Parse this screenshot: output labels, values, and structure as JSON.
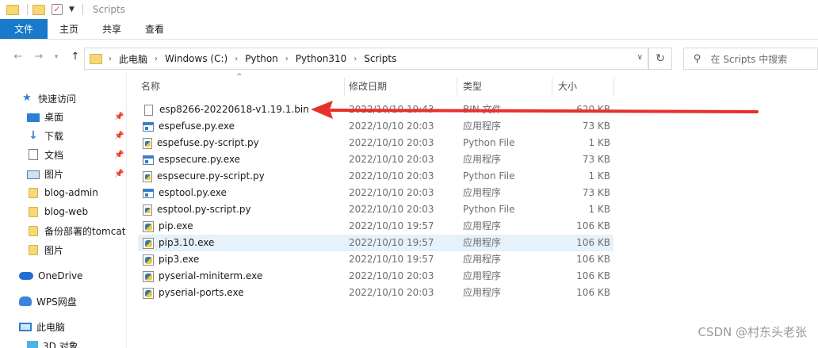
{
  "titlebar": {
    "title": "Scripts"
  },
  "ribbon": {
    "tabs": [
      "文件",
      "主页",
      "共享",
      "查看"
    ]
  },
  "address": {
    "breadcrumbs": [
      "此电脑",
      "Windows (C:)",
      "Python",
      "Python310",
      "Scripts"
    ]
  },
  "search": {
    "placeholder": "在 Scripts 中搜索"
  },
  "nav": {
    "quick_access": "快速访问",
    "items": [
      {
        "label": "桌面",
        "icon": "desktop-icon",
        "pinned": true
      },
      {
        "label": "下载",
        "icon": "download-icon",
        "pinned": true
      },
      {
        "label": "文档",
        "icon": "document-icon",
        "pinned": true
      },
      {
        "label": "图片",
        "icon": "picture-icon",
        "pinned": true
      },
      {
        "label": "blog-admin",
        "icon": "folder-icon",
        "pinned": false
      },
      {
        "label": "blog-web",
        "icon": "folder-icon",
        "pinned": false
      },
      {
        "label": "备份部署的tomcat",
        "icon": "folder-icon",
        "pinned": false
      },
      {
        "label": "图片",
        "icon": "folder-icon",
        "pinned": false
      }
    ],
    "onedrive": "OneDrive",
    "wps": "WPS网盘",
    "this_pc": "此电脑",
    "objects_3d": "3D 对象"
  },
  "columns": {
    "name": "名称",
    "date": "修改日期",
    "type": "类型",
    "size": "大小"
  },
  "files": [
    {
      "name": "esp8266-20220618-v1.19.1.bin",
      "date": "2022/10/10 19:43",
      "type": "BIN 文件",
      "size": "620 KB",
      "icon": "bin"
    },
    {
      "name": "espefuse.py.exe",
      "date": "2022/10/10 20:03",
      "type": "应用程序",
      "size": "73 KB",
      "icon": "exe"
    },
    {
      "name": "espefuse.py-script.py",
      "date": "2022/10/10 20:03",
      "type": "Python File",
      "size": "1 KB",
      "icon": "py"
    },
    {
      "name": "espsecure.py.exe",
      "date": "2022/10/10 20:03",
      "type": "应用程序",
      "size": "73 KB",
      "icon": "exe"
    },
    {
      "name": "espsecure.py-script.py",
      "date": "2022/10/10 20:03",
      "type": "Python File",
      "size": "1 KB",
      "icon": "py"
    },
    {
      "name": "esptool.py.exe",
      "date": "2022/10/10 20:03",
      "type": "应用程序",
      "size": "73 KB",
      "icon": "exe"
    },
    {
      "name": "esptool.py-script.py",
      "date": "2022/10/10 20:03",
      "type": "Python File",
      "size": "1 KB",
      "icon": "py"
    },
    {
      "name": "pip.exe",
      "date": "2022/10/10 19:57",
      "type": "应用程序",
      "size": "106 KB",
      "icon": "pyexe"
    },
    {
      "name": "pip3.10.exe",
      "date": "2022/10/10 19:57",
      "type": "应用程序",
      "size": "106 KB",
      "icon": "pyexe",
      "selected": true
    },
    {
      "name": "pip3.exe",
      "date": "2022/10/10 19:57",
      "type": "应用程序",
      "size": "106 KB",
      "icon": "pyexe"
    },
    {
      "name": "pyserial-miniterm.exe",
      "date": "2022/10/10 20:03",
      "type": "应用程序",
      "size": "106 KB",
      "icon": "pyexe"
    },
    {
      "name": "pyserial-ports.exe",
      "date": "2022/10/10 20:03",
      "type": "应用程序",
      "size": "106 KB",
      "icon": "pyexe"
    }
  ],
  "annotation": {
    "arrow_color": "#e8302a"
  },
  "watermark": "CSDN @村东头老张"
}
